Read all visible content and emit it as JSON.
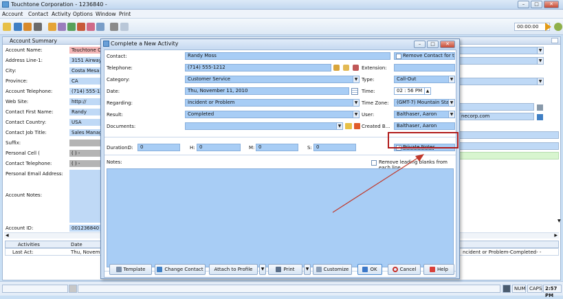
{
  "app": {
    "title": "Touchtone Corporation - 1236840 -",
    "timer": "00:00:00"
  },
  "menu": [
    "Account",
    "Contact",
    "Activity",
    "Options",
    "Window",
    "Print"
  ],
  "account": {
    "header": "Account Summary",
    "rows": [
      {
        "label": "Account Name:",
        "value": "Touchtone Co",
        "style": "pink"
      },
      {
        "label": "Address Line-1:",
        "value": "3151 Airway A"
      },
      {
        "label": "City:",
        "value": "Costa Mesa"
      },
      {
        "label": "Province:",
        "value": "CA"
      },
      {
        "label": "Account Telephone:",
        "value": "(714) 555-121"
      },
      {
        "label": "Web Site:",
        "value": "http://"
      },
      {
        "label": "Contact First Name:",
        "value": "Randy"
      },
      {
        "label": "Contact Country:",
        "value": "USA"
      },
      {
        "label": "Contact Job Title:",
        "value": "Sales Manage"
      },
      {
        "label": "Suffix:",
        "value": "",
        "style": "gray"
      },
      {
        "label": "Personal Cell (",
        "value": "(  )  -",
        "style": "gray"
      },
      {
        "label": "Contact Telephone:",
        "value": "(  )  -",
        "style": "gray"
      },
      {
        "label": "Personal Email Address:",
        "value": "",
        "style": "gray"
      }
    ],
    "notes_label": "Account Notes:",
    "id_label": "Account ID:",
    "id_value": "001236840",
    "email_partial": "necorp.com",
    "grid_headers": [
      "Activities",
      "Date"
    ],
    "grid_row": [
      "Last Act:",
      "Thu, November"
    ],
    "grid_right": "ncident or Problem-Completed- -"
  },
  "status": {
    "num": "NUM",
    "caps": "CAPS",
    "time": "2:57 PM"
  },
  "dialog": {
    "title": "Complete a New Activity",
    "contact_label": "Contact:",
    "contact": "Randy Moss",
    "remove_contact": "Remove Contact for th...",
    "telephone_label": "Telephone:",
    "telephone": "(714) 555-1212",
    "extension_label": "Extension:",
    "extension": "",
    "category_label": "Category:",
    "category": "Customer Service",
    "type_label": "Type:",
    "type": "Call-Out",
    "date_label": "Date:",
    "date": "Thu, November 11, 2010",
    "time_label": "Time:",
    "time": "02 : 56  PM",
    "regarding_label": "Regarding:",
    "regarding": "Incident or Problem",
    "timezone_label": "Time Zone:",
    "timezone": "(GMT-7) Mountain Stan...",
    "result_label": "Result:",
    "result": "Completed",
    "user_label": "User:",
    "user": "Balthaser, Aaron",
    "documents_label": "Documents:",
    "documents": "",
    "createdby_label": "Created B...",
    "createdby": "Balthaser, Aaron",
    "duration_label": "Duration:",
    "d_label": "D:",
    "d": "0",
    "h_label": "H:",
    "h": "0",
    "m_label": "M:",
    "m": "0",
    "s_label": "S:",
    "s": "0",
    "private_notes": "Private Notes",
    "notes_label": "Notes:",
    "remove_leading": "Remove leading blanks from each line",
    "buttons": {
      "template": "Template",
      "change_contact": "Change Contact",
      "attach": "Attach to Profile",
      "print": "Print",
      "customize": "Customize",
      "ok": "OK",
      "cancel": "Cancel",
      "help": "Help"
    }
  },
  "colors": {
    "accent": "#a8cdf5",
    "highlight": "#b01a1a",
    "arrow": "#c0392b"
  }
}
